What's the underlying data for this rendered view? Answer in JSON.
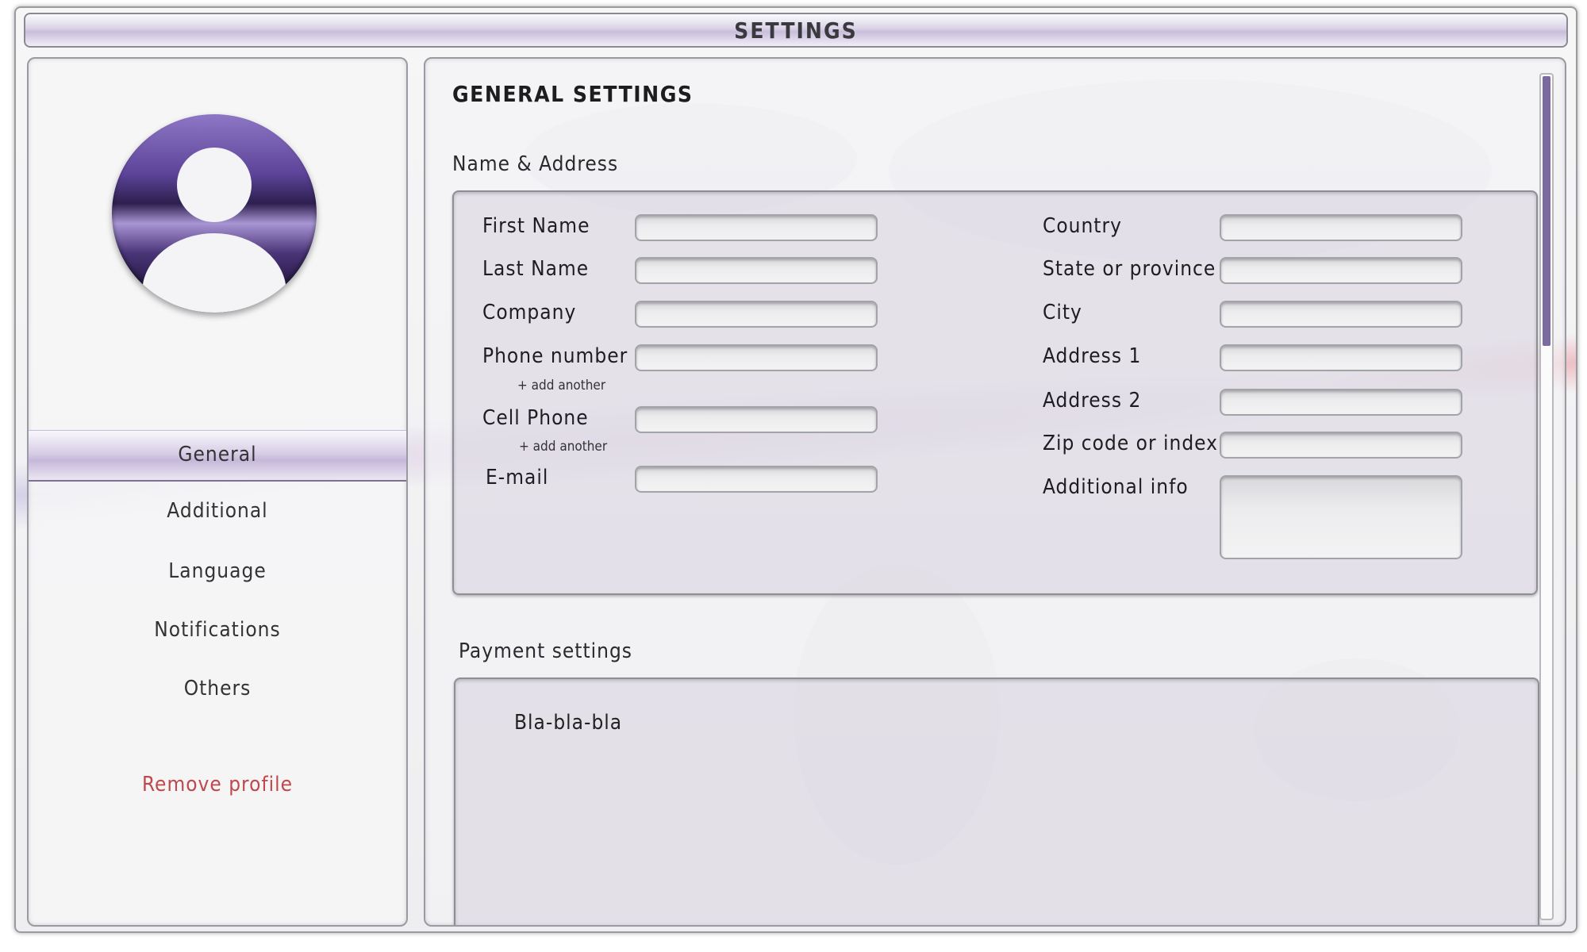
{
  "window": {
    "title": "SETTINGS"
  },
  "sidebar": {
    "items": [
      {
        "label": "General",
        "active": true
      },
      {
        "label": "Additional",
        "active": false
      },
      {
        "label": "Language",
        "active": false
      },
      {
        "label": "Notifications",
        "active": false
      },
      {
        "label": "Others",
        "active": false
      }
    ],
    "remove_label": "Remove profile"
  },
  "main": {
    "title": "GENERAL SETTINGS",
    "name_address": {
      "title": "Name & Address",
      "left": {
        "first_name": "First Name",
        "last_name": "Last Name",
        "company": "Company",
        "phone": "Phone number",
        "phone_add": "+ add another",
        "cell": "Cell Phone",
        "cell_add": "+ add another",
        "email": "E-mail"
      },
      "right": {
        "country": "Country",
        "state": "State or province",
        "city": "City",
        "address1": "Address 1",
        "address2": "Address 2",
        "zip": "Zip code or index",
        "additional_info": "Additional info"
      },
      "values": {
        "first_name": "",
        "last_name": "",
        "company": "",
        "phone": "",
        "cell": "",
        "email": "",
        "country": "",
        "state": "",
        "city": "",
        "address1": "",
        "address2": "",
        "zip": "",
        "additional_info": ""
      }
    },
    "payment": {
      "title": "Payment settings",
      "text": "Bla-bla-bla"
    }
  },
  "colors": {
    "accent": "#7b6a9d",
    "danger": "#c0484a",
    "avatar": "#5d4499"
  },
  "icons": {
    "avatar": "user-avatar-icon"
  }
}
